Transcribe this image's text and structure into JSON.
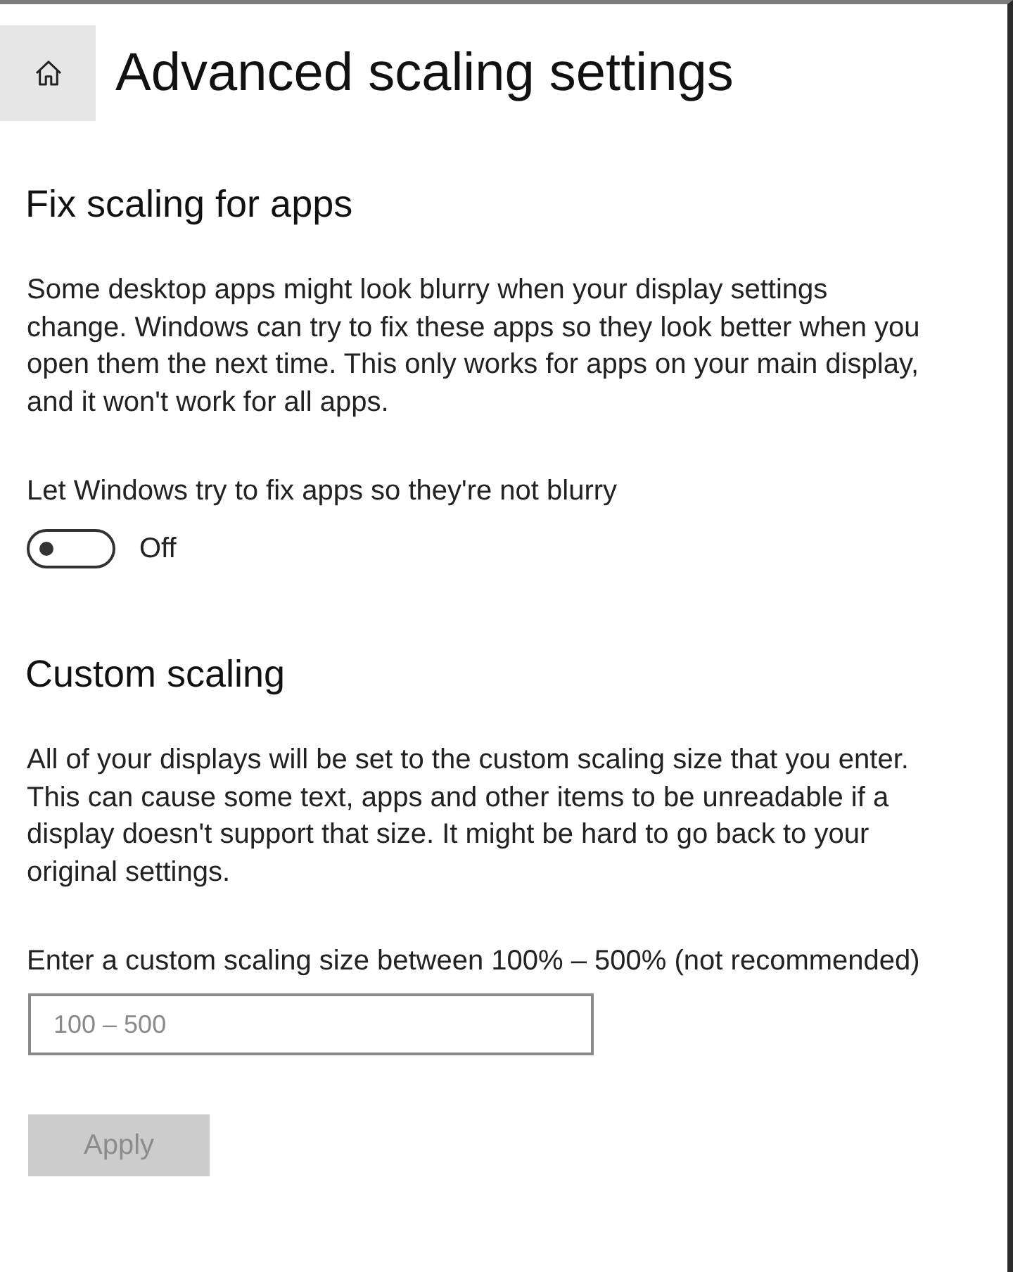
{
  "header": {
    "title": "Advanced scaling settings"
  },
  "sections": [
    {
      "kind": "toggle",
      "heading": "Fix scaling for apps",
      "description": "Some desktop apps might look blurry when your display settings change. Windows can try to fix these apps so they look better when you open them the next time. This only works for apps on your main display, and it won't work for all apps.",
      "toggle": {
        "label": "Let Windows try to fix apps so they're not blurry",
        "on": false,
        "state_text": "Off"
      }
    },
    {
      "kind": "input",
      "heading": "Custom scaling",
      "description": "All of your displays will be set to the custom scaling size that you enter. This can cause some text, apps and other items to be unreadable if a display doesn't support that size. It might be hard to go back to your original settings.",
      "field": {
        "label": "Enter a custom scaling size between 100% – 500% (not recommended)",
        "placeholder": "100 – 500"
      },
      "button": {
        "label": "Apply",
        "disabled": true
      }
    }
  ]
}
